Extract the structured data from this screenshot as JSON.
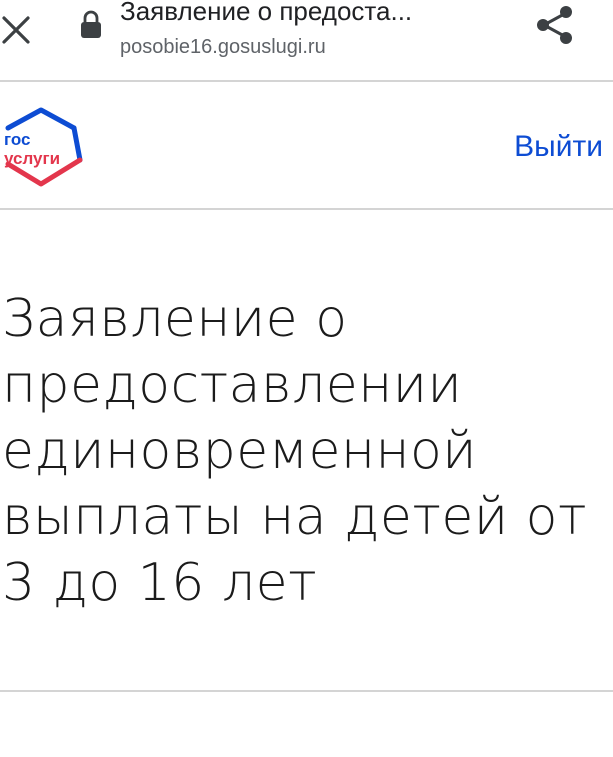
{
  "browser": {
    "tab_title": "Заявление о предоста...",
    "domain": "posobie16.gosuslugi.ru"
  },
  "header": {
    "logo": {
      "line1": "гос",
      "line2": "услуги"
    },
    "logout_label": "Выйти"
  },
  "main": {
    "title_lines": [
      "Заявление о",
      "предоставлении",
      "единовременной",
      "выплаты на детей от",
      "3 до 16 лет"
    ]
  },
  "colors": {
    "link": "#0d4cd3",
    "logo_blue": "#0d4cd3",
    "logo_red": "#e3364c"
  },
  "icons": {
    "close": "close-icon",
    "lock": "lock-icon",
    "share": "share-icon"
  }
}
